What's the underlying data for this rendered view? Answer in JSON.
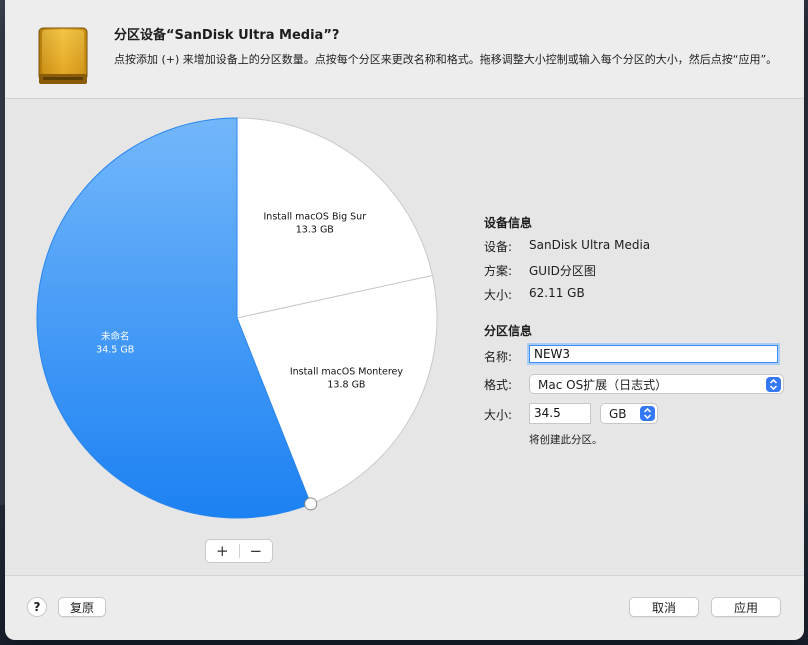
{
  "dialog": {
    "title": "分区设备“SanDisk Ultra Media”?",
    "subtitle": "点按添加 (+) 来增加设备上的分区数量。点按每个分区来更改名称和格式。拖移调整大小控制或输入每个分区的大小，然后点按“应用”。"
  },
  "icons": {
    "drive": "external-drive-icon",
    "help": "help-icon",
    "stepper": "stepper-icon"
  },
  "colors": {
    "accent": "#3478f6",
    "pie_selected": "#2f8cf4",
    "pie_unselected": "#ffffff"
  },
  "chart_data": {
    "type": "pie",
    "slices": [
      {
        "name": "Install macOS Big Sur",
        "size": "13.3 GB",
        "value": 13.3
      },
      {
        "name": "Install macOS Monterey",
        "size": "13.8 GB",
        "value": 13.8
      },
      {
        "name": "未命名",
        "size": "34.5 GB",
        "value": 34.5
      }
    ]
  },
  "pie_buttons": {
    "add": "+",
    "remove": "−"
  },
  "device_info": {
    "title": "设备信息",
    "rows": [
      {
        "label": "设备:",
        "value": "SanDisk Ultra Media"
      },
      {
        "label": "方案:",
        "value": "GUID分区图"
      },
      {
        "label": "大小:",
        "value": "62.11 GB"
      }
    ]
  },
  "partition_info": {
    "title": "分区信息",
    "name_label": "名称:",
    "name_value": "NEW3",
    "format_label": "格式:",
    "format_value": "Mac OS扩展（日志式）",
    "size_label": "大小:",
    "size_value": "34.5",
    "size_unit": "GB",
    "note": "将创建此分区。"
  },
  "footer": {
    "help": "?",
    "revert": "复原",
    "cancel": "取消",
    "apply": "应用"
  }
}
